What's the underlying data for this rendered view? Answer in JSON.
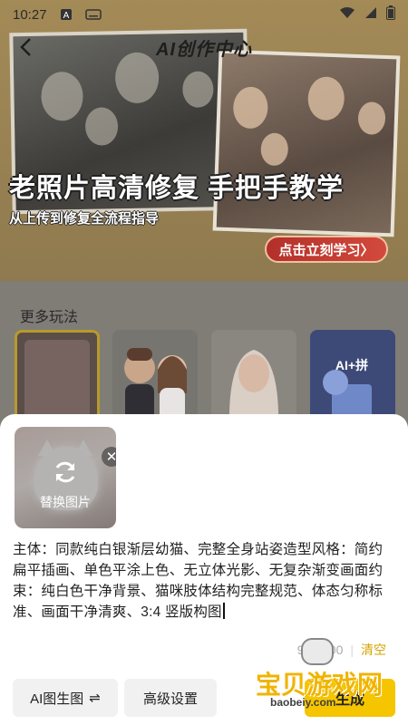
{
  "status_bar": {
    "time": "10:27",
    "icons": [
      "text-notification-icon",
      "keyboard-icon",
      "wifi-icon",
      "signal-icon",
      "battery-icon"
    ]
  },
  "header": {
    "title": "AI创作中心",
    "back_icon": "back-arrow-icon"
  },
  "banner": {
    "title": "老照片高清修复 手把手教学",
    "subtitle": "从上传到修复全流程指导",
    "cta_label": "点击立刻学习〉"
  },
  "more": {
    "title": "更多玩法",
    "items": [
      {
        "name": "blurred-portrait-style"
      },
      {
        "name": "cartoon-couple-style"
      },
      {
        "name": "realistic-portrait-style"
      },
      {
        "name": "ai-puzzle-style",
        "badge": "AI+拼"
      }
    ]
  },
  "sheet": {
    "image": {
      "replace_label": "替换图片",
      "close_symbol": "✕"
    },
    "prompt_text": "主体：同款纯白银渐层幼猫、完整全身站姿造型风格：简约扁平插画、单色平涂上色、无立体光影、无复杂渐变画面约束：纯白色干净背景、猫咪肢体结构完整规范、体态匀称标准、画面干净清爽、3:4 竖版构图",
    "counter": "95/1000",
    "clear_label": "清空",
    "mode_label": "AI图生图",
    "mode_icon": "⇌",
    "advanced_label": "高级设置",
    "generate_label": "生成"
  },
  "watermark": {
    "text": "宝贝游戏网",
    "url": "baobeiy.com"
  },
  "colors": {
    "accent": "#f5c500",
    "clear": "#d6a300",
    "cta": "#c23a30"
  }
}
